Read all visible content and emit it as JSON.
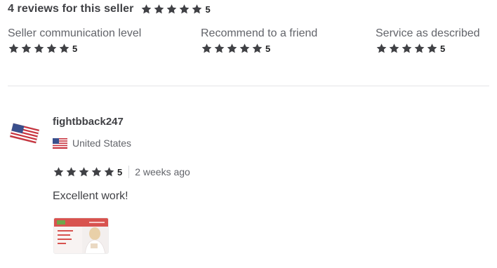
{
  "header": {
    "title": "4 reviews for this seller",
    "rating": "5"
  },
  "breakdown": [
    {
      "label": "Seller communication level",
      "rating": "5"
    },
    {
      "label": "Recommend to a friend",
      "rating": "5"
    },
    {
      "label": "Service as described",
      "rating": "5"
    }
  ],
  "review": {
    "username": "fightbback247",
    "country": "United States",
    "rating": "5",
    "time_ago": "2 weeks ago",
    "text": "Excellent work!",
    "attachment_icon": "delivery-thumbnail"
  },
  "colors": {
    "star": "#404145",
    "text": "#404145",
    "muted": "#62646a",
    "divider": "#e4e5e7"
  }
}
